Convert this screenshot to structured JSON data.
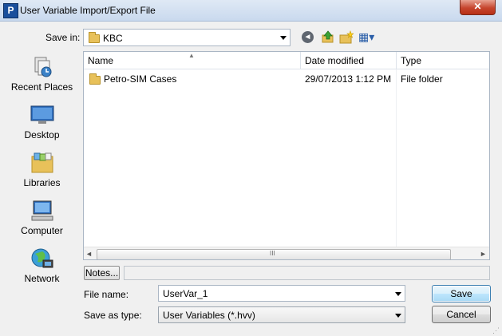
{
  "window": {
    "title": "User Variable Import/Export File",
    "app_icon_letter": "P",
    "close_glyph": "✕"
  },
  "savein": {
    "label": "Save in:",
    "value": "KBC"
  },
  "toolbar": {
    "back_glyph": "◄",
    "views_glyph": "▦▾"
  },
  "places": [
    {
      "label": "Recent Places",
      "icon": "recent-places-icon"
    },
    {
      "label": "Desktop",
      "icon": "desktop-icon"
    },
    {
      "label": "Libraries",
      "icon": "libraries-icon"
    },
    {
      "label": "Computer",
      "icon": "computer-icon"
    },
    {
      "label": "Network",
      "icon": "network-icon"
    }
  ],
  "filelist": {
    "columns": {
      "name": "Name",
      "date": "Date modified",
      "type": "Type"
    },
    "sort_glyph": "▲",
    "rows": [
      {
        "name": "Petro-SIM Cases",
        "date": "29/07/2013 1:12 PM",
        "type": "File folder"
      }
    ],
    "scroll": {
      "left": "◄",
      "right": "►",
      "grip": "III"
    }
  },
  "notes": {
    "button": "Notes..."
  },
  "filename": {
    "label": "File name:",
    "value": "UserVar_1"
  },
  "filetype": {
    "label": "Save as type:",
    "value": "User Variables (*.hvv)"
  },
  "buttons": {
    "save": "Save",
    "cancel": "Cancel"
  },
  "grip_glyph": "⋰"
}
